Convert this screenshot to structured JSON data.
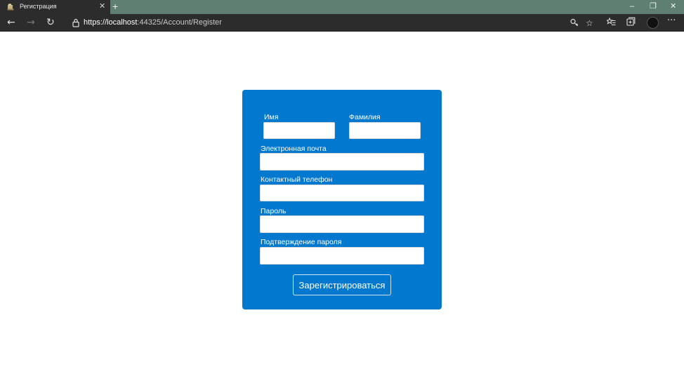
{
  "browser": {
    "tab_title": "Регистрация",
    "tab_close": "✕",
    "new_tab": "+",
    "window_controls": {
      "minimize": "–",
      "restore": "❐",
      "close": "✕"
    },
    "url_protocol": "https://",
    "url_host": "localhost",
    "url_rest": ":44325/Account/Register",
    "more_menu": "···",
    "icons": [
      "back-arrow-icon",
      "forward-arrow-icon",
      "refresh-icon",
      "lock-icon",
      "key-icon",
      "star-icon",
      "favorites-icon",
      "collections-icon",
      "profile-avatar",
      "more-icon"
    ]
  },
  "form": {
    "first_name_label": "Имя",
    "last_name_label": "Фамилия",
    "email_label": "Электронная почта",
    "phone_label": "Контактный телефон",
    "password_label": "Пароль",
    "confirm_password_label": "Подтверждение пароля",
    "first_name_value": "",
    "last_name_value": "",
    "email_value": "",
    "phone_value": "",
    "password_value": "",
    "confirm_password_value": "",
    "submit_label": "Зарегистрироваться"
  },
  "colors": {
    "tabstrip": "#5e7f72",
    "toolbar": "#2c2c2c",
    "card": "#0378cf",
    "page": "#ffffff"
  }
}
